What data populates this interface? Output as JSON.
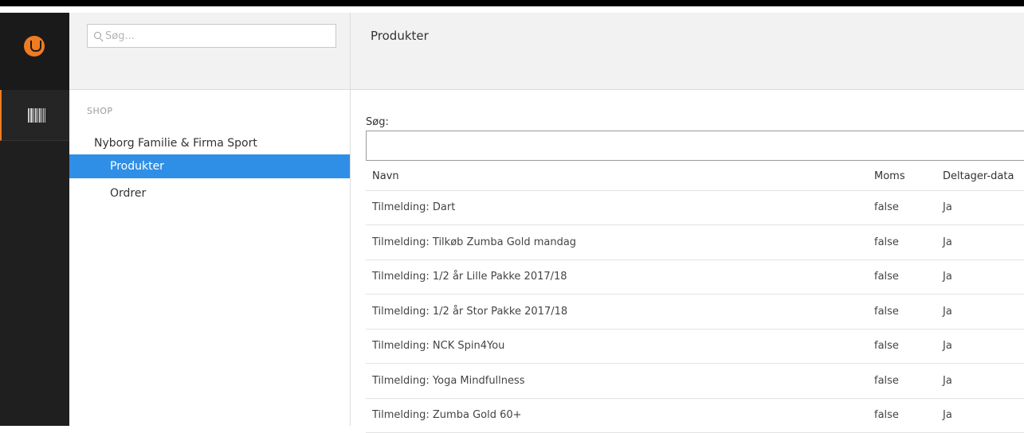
{
  "rail": {
    "logo": "umbraco-logo-icon",
    "section_icon": "barcode-icon",
    "accent": "#f07b22"
  },
  "sidebar": {
    "search_placeholder": "Søg...",
    "section_label": "SHOP",
    "root": "Nyborg Familie & Firma Sport",
    "items": [
      {
        "label": "Produkter",
        "active": true
      },
      {
        "label": "Ordrer",
        "active": false
      }
    ],
    "active_color": "#2f8fe6"
  },
  "main": {
    "title": "Produkter",
    "filter_label": "Søg:",
    "filter_value": "",
    "columns": [
      "Navn",
      "Moms",
      "Deltager-data"
    ],
    "rows": [
      [
        "Tilmelding: Dart",
        "false",
        "Ja"
      ],
      [
        "Tilmelding: Tilkøb Zumba Gold mandag",
        "false",
        "Ja"
      ],
      [
        "Tilmelding: 1/2 år Lille Pakke 2017/18",
        "false",
        "Ja"
      ],
      [
        "Tilmelding: 1/2 år Stor Pakke 2017/18",
        "false",
        "Ja"
      ],
      [
        "Tilmelding: NCK Spin4You",
        "false",
        "Ja"
      ],
      [
        "Tilmelding: Yoga Mindfullness",
        "false",
        "Ja"
      ],
      [
        "Tilmelding: Zumba Gold 60+",
        "false",
        "Ja"
      ]
    ]
  }
}
